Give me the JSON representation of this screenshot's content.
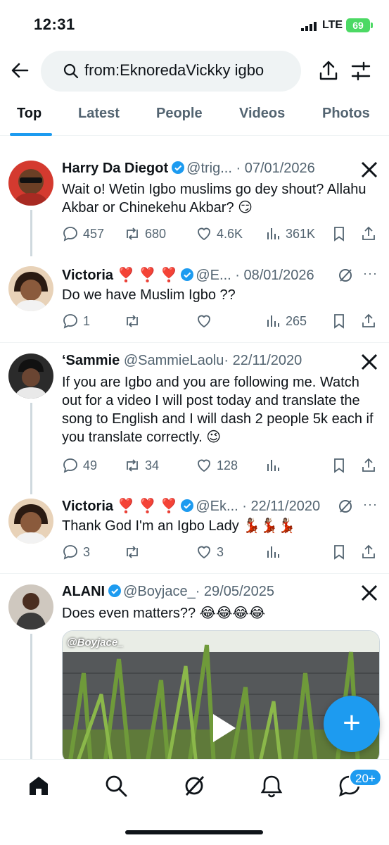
{
  "status_bar": {
    "time": "12:31",
    "network": "LTE",
    "battery": "69"
  },
  "search": {
    "query": "from:EknoredaVickky igbo"
  },
  "tabs": [
    {
      "label": "Top",
      "active": true
    },
    {
      "label": "Latest",
      "active": false
    },
    {
      "label": "People",
      "active": false
    },
    {
      "label": "Videos",
      "active": false
    },
    {
      "label": "Photos",
      "active": false
    }
  ],
  "tweets": [
    {
      "name": "Harry Da Diegot",
      "handle": "@trig...",
      "date": "· 07/01/2026",
      "text": "Wait o! Wetin Igbo muslims go dey shout? Allahu Akbar or Chinekehu Akbar? 😏",
      "replies": "457",
      "retweets": "680",
      "likes": "4.6K",
      "views": "361K"
    },
    {
      "name": "Victoria ❣️ ❣️ ❣️",
      "handle": "@E...",
      "date": "· 08/01/2026",
      "text": "Do we have Muslim Igbo ??",
      "replies": "1",
      "retweets": "",
      "likes": "",
      "views": "265"
    },
    {
      "name": "‘Sammie",
      "handle": "@SammieLaolu",
      "date": "· 22/11/2020",
      "text": "If you are Igbo and you are following me. Watch out for a video I will post today and translate the song to English and I will dash 2 people 5k each if you translate correctly. 😉",
      "replies": "49",
      "retweets": "34",
      "likes": "128",
      "views": ""
    },
    {
      "name": "Victoria ❣️ ❣️ ❣️",
      "handle": "@Ek...",
      "date": "· 22/11/2020",
      "text": "Thank God I'm an Igbo Lady 💃🏽💃🏽💃🏽",
      "replies": "3",
      "retweets": "",
      "likes": "3",
      "views": ""
    },
    {
      "name": "ALANI",
      "handle": "@Boyjace_",
      "date": "· 29/05/2025",
      "text": "Does even matters?? 😂😂😂😂",
      "media_watermark": "@Boyjace_"
    }
  ],
  "fab": {
    "label": "+"
  },
  "bottom_nav": {
    "notifications_badge": "20+"
  },
  "colors": {
    "accent": "#1d9bf0",
    "text": "#0f1419",
    "muted": "#536471",
    "verified": "#1d9bf0"
  }
}
